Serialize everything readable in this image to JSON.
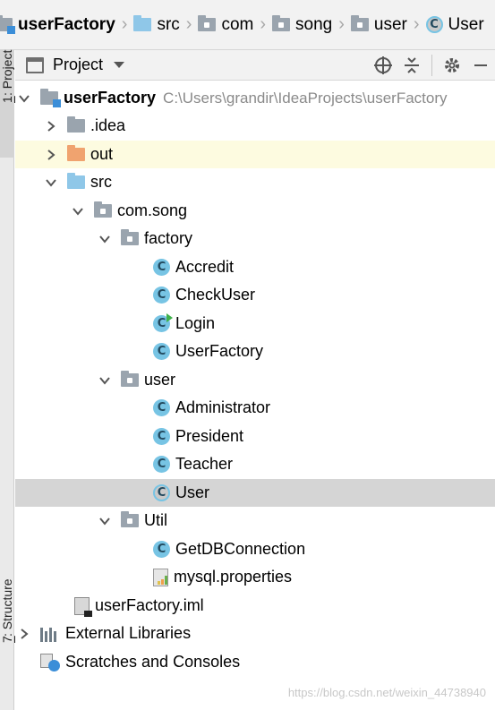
{
  "breadcrumb": [
    {
      "label": "userFactory",
      "icon": "module-folder-icon",
      "bold": true
    },
    {
      "label": "src",
      "icon": "source-folder-icon"
    },
    {
      "label": "com",
      "icon": "package-icon"
    },
    {
      "label": "song",
      "icon": "package-icon"
    },
    {
      "label": "user",
      "icon": "package-icon"
    },
    {
      "label": "User",
      "icon": "class-icon"
    }
  ],
  "left_strip": {
    "project_tab": {
      "number": "1",
      "label": ": Project"
    },
    "structure_tab": {
      "number": "7",
      "label": ": Structure"
    }
  },
  "tool_window": {
    "title": "Project",
    "actions": [
      "locate-icon",
      "collapse-all-icon",
      "gear-icon",
      "hide-icon"
    ]
  },
  "tree": {
    "root": {
      "label": "userFactory",
      "path": "C:\\Users\\grandir\\IdeaProjects\\userFactory"
    },
    "idea": {
      "label": ".idea"
    },
    "out": {
      "label": "out"
    },
    "src": {
      "label": "src"
    },
    "com_song": {
      "label": "com.song"
    },
    "factory": {
      "label": "factory"
    },
    "accredit": {
      "label": "Accredit"
    },
    "checkuser": {
      "label": "CheckUser"
    },
    "login": {
      "label": "Login"
    },
    "userfactory_class": {
      "label": "UserFactory"
    },
    "user_pkg": {
      "label": "user"
    },
    "administrator": {
      "label": "Administrator"
    },
    "president": {
      "label": "President"
    },
    "teacher": {
      "label": "Teacher"
    },
    "user_class": {
      "label": "User"
    },
    "util": {
      "label": "Util"
    },
    "getdbconnection": {
      "label": "GetDBConnection"
    },
    "mysql_props": {
      "label": "mysql.properties"
    },
    "iml": {
      "label": "userFactory.iml"
    },
    "external_libraries": {
      "label": "External Libraries"
    },
    "scratches": {
      "label": "Scratches and Consoles"
    }
  },
  "watermark": "https://blog.csdn.net/weixin_44738940",
  "colors": {
    "selection": "#d5d5d5",
    "highlight": "#fdfbe0",
    "class_icon": "#77c4e4",
    "excluded_folder": "#f0a36f",
    "source_folder": "#8fc7e8"
  }
}
